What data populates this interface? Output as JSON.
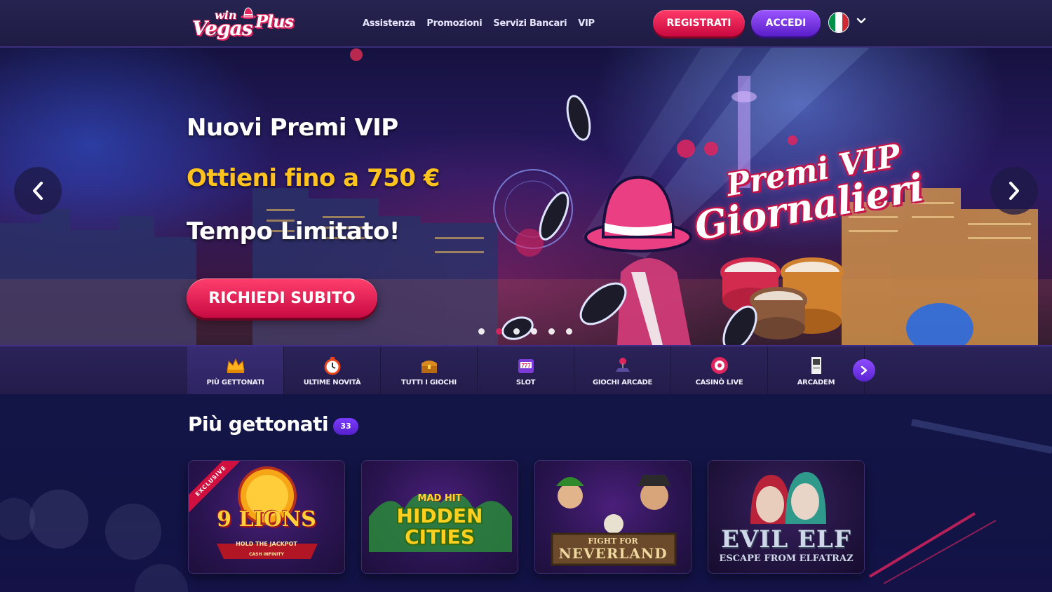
{
  "header": {
    "logo": {
      "small": "win",
      "main": "Vegas",
      "tail": "Plus"
    },
    "nav": [
      "Assistenza",
      "Promozioni",
      "Servizi Bancari",
      "VIP"
    ],
    "register_label": "REGISTRATI",
    "login_label": "ACCEDI",
    "language_flag": {
      "name": "italy-flag-icon",
      "colors": [
        "#009246",
        "#ffffff",
        "#ce2b37"
      ]
    }
  },
  "hero": {
    "title": "Nuovi Premi VIP",
    "offer": "Ottieni fino a 750 €",
    "limited": "Tempo Limitato!",
    "cta_label": "RICHIEDI SUBITO",
    "promo_line1": "Premi VIP",
    "promo_line2": "Giornalieri",
    "slides": 6,
    "active_slide": 2
  },
  "categories": [
    {
      "label": "PIÙ GETTONATI",
      "icon": "crown-icon",
      "active": true
    },
    {
      "label": "ULTIME NOVITÀ",
      "icon": "stopwatch-icon",
      "active": false
    },
    {
      "label": "TUTTI I GIOCHI",
      "icon": "treasure-chest-icon",
      "active": false
    },
    {
      "label": "SLOT",
      "icon": "slot-machine-icon",
      "active": false
    },
    {
      "label": "GIOCHI ARCADE",
      "icon": "joystick-icon",
      "active": false
    },
    {
      "label": "CASINÒ LIVE",
      "icon": "roulette-chip-icon",
      "active": false
    },
    {
      "label": "ARCADEM",
      "icon": "arcade-cabinet-icon",
      "active": false
    }
  ],
  "section": {
    "title": "Più gettonati",
    "count": "33"
  },
  "games": [
    {
      "title": "9 LIONS",
      "subtitle": "HOLD THE JACKPOT",
      "tagline": "CASH INFINITY",
      "badge": "EXCLUSIVE"
    },
    {
      "title": "HIDDEN CITIES",
      "subtitle": "MAD HIT"
    },
    {
      "title": "NEVERLAND",
      "subtitle": "FIGHT FOR"
    },
    {
      "title": "EVIL ELF",
      "subtitle": "ESCAPE FROM ELFATRAZ"
    }
  ],
  "colors": {
    "accent_red": "#e0245e",
    "accent_purple": "#6a2be0",
    "offer_yellow": "#ffc31f",
    "header_bg": "#231f4b"
  }
}
